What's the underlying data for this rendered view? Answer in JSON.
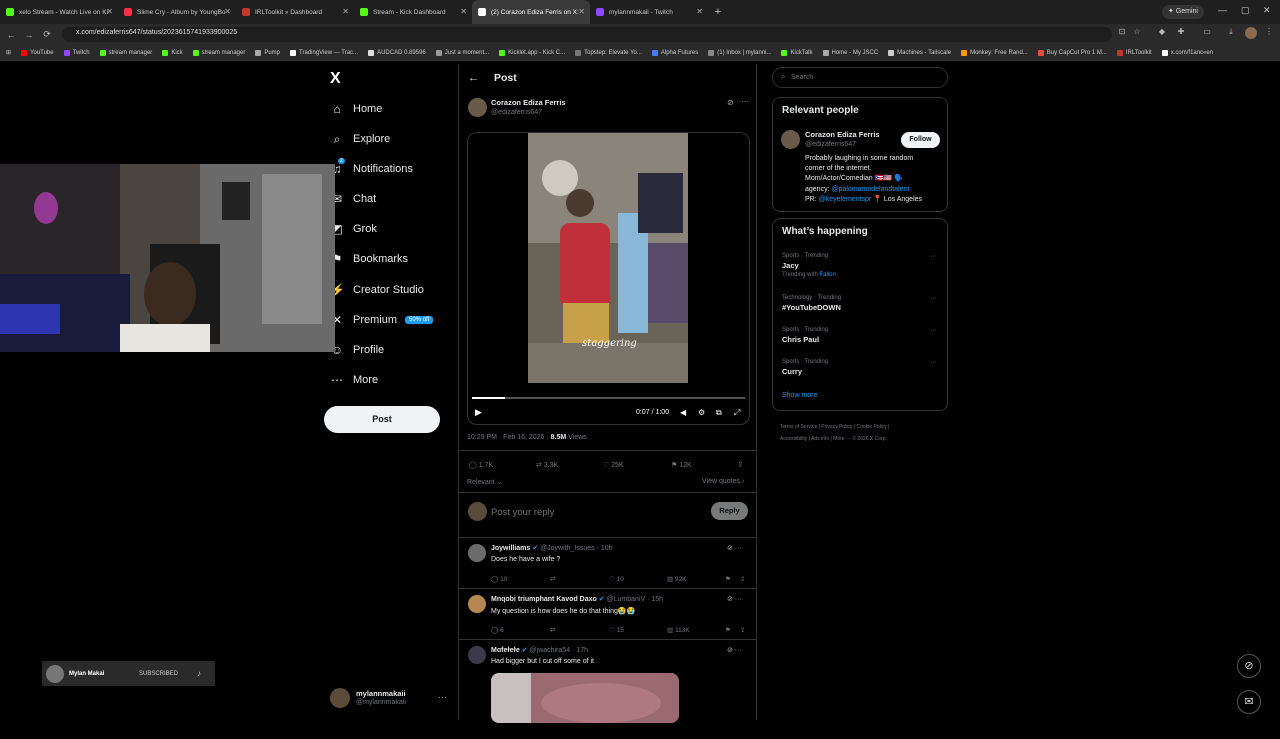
{
  "browser": {
    "tabs": [
      {
        "title": "xelo Stream - Watch Live on Ki",
        "color": "#53fc18"
      },
      {
        "title": "Slime Cry - Album by YoungBo",
        "color": "#fa2d48"
      },
      {
        "title": "IRLToolkit » Dashboard",
        "color": "#c0392b"
      },
      {
        "title": "Stream - Kick Dashboard",
        "color": "#53fc18"
      },
      {
        "title": "(2) Corazon Ediza Ferris on X:",
        "color": "#ffffff"
      },
      {
        "title": "mylannmakaii - Twitch",
        "color": "#9146ff"
      }
    ],
    "new_tab": "+",
    "gemini": "Gemini",
    "url": "x.com/edizaferris647/status/2023615741933900025",
    "bookmarks": [
      "YouTube",
      "Twitch",
      "stream manager",
      "Kick",
      "stream manager",
      "Pump",
      "TradingView — Trac...",
      "AUDCAD 0.89596",
      "Just a moment...",
      "Kicklet.app - Kick C...",
      "Topstep: Elevate Yo...",
      "Alpha Futures",
      "(1) Inbox | mylanni...",
      "KickTalk",
      "Home - My JSCC",
      "Machines - Tailscale",
      "Monkey: Free Rand...",
      "Buy CapCut Pro 1 M...",
      "IRLToolkit",
      "x.com/f1anc«en"
    ]
  },
  "sidebar": {
    "logo": "X",
    "items": [
      {
        "label": "Home",
        "icon": "home-icon",
        "glyph": "⌂"
      },
      {
        "label": "Explore",
        "icon": "search-icon",
        "glyph": "⌕"
      },
      {
        "label": "Notifications",
        "icon": "bell-icon",
        "glyph": "♫"
      },
      {
        "label": "Chat",
        "icon": "chat-icon",
        "glyph": "✉"
      },
      {
        "label": "Grok",
        "icon": "grok-icon",
        "glyph": "◩"
      },
      {
        "label": "Bookmarks",
        "icon": "bookmark-icon",
        "glyph": "⚑"
      },
      {
        "label": "Creator Studio",
        "icon": "creator-icon",
        "glyph": "⚡"
      },
      {
        "label": "Premium",
        "icon": "x-premium-icon",
        "glyph": "✕"
      },
      {
        "label": "Profile",
        "icon": "profile-icon",
        "glyph": "☺"
      },
      {
        "label": "More",
        "icon": "more-icon",
        "glyph": "⋯"
      }
    ],
    "premium_badge": "50% off",
    "notif_count": "2",
    "post_button": "Post",
    "account_name": "mylannmakaii",
    "account_handle": "@mylannmakaii"
  },
  "overlay": {
    "sub_name": "Mylan Makai",
    "sub_status": "SUBSCRIBED"
  },
  "post": {
    "header": "Post",
    "author": "Corazon Ediza Ferris",
    "handle": "@edizaferris647",
    "caption": "staggering",
    "video_time": "0:07 / 1:00",
    "video_progress": 0.12,
    "timestamp": "10:29 PM · Feb 16, 2026 · ",
    "views": "8.5M",
    "views_label": " Views",
    "replies": "1.7K",
    "reposts": "3.3K",
    "likes": "25K",
    "bookmarks": "12K",
    "sort": "Relevant",
    "view_quotes": "View quotes",
    "reply_placeholder": "Post your reply",
    "reply_button": "Reply"
  },
  "replies": [
    {
      "name": "Joywilliams",
      "handle": "@Joywith_Issues · 10h",
      "text": "Does he have a wife ?",
      "replies": "10",
      "likes": "10",
      "views": "92K",
      "avatar": "#6b6b6b"
    },
    {
      "name": "Mnqobi triumphant Kavod Daxo",
      "handle": "@LumbaniV · 15h",
      "text": "My question is how does he do that thing😭😭",
      "replies": "6",
      "likes": "15",
      "views": "113K",
      "avatar": "#b48850"
    },
    {
      "name": "Mɑfeɫeɫe",
      "handle": "@jwachira54 · 17h",
      "text": "Had bigger but I cut off some of it",
      "replies": "",
      "likes": "",
      "views": "",
      "avatar": "#3a3a4a"
    }
  ],
  "right": {
    "search_placeholder": "Search",
    "relevant_title": "Relevant people",
    "rp_name": "Corazon Ediza Ferris",
    "rp_handle": "@edizaferris647",
    "follow": "Follow",
    "bio1": "Probably laughing in some random",
    "bio2": "corner of the internet.",
    "bio3": "Mom/Actor/Comedian 🇵🇷🇺🇸 🗣️",
    "bio4a": "agency: ",
    "bio4b": "@palomamodelandtalent",
    "bio5a": "PR: ",
    "bio5b": "@keyelementspr",
    "bio5c": " 📍 Los Angeles",
    "happening_title": "What’s happening",
    "trends": [
      {
        "context": "Sports · Trending",
        "title": "Jacy",
        "extra": "Trending with ",
        "extra_link": "Fallon"
      },
      {
        "context": "Technology · Trending",
        "title": "#YouTubeDOWN",
        "extra": "",
        "extra_link": ""
      },
      {
        "context": "Sports · Trending",
        "title": "Chris Paul",
        "extra": "",
        "extra_link": ""
      },
      {
        "context": "Sports · Trending",
        "title": "Curry",
        "extra": "",
        "extra_link": ""
      }
    ],
    "show_more": "Show more",
    "footer1": "Terms of Service  |  Privacy Policy  |  Cookie Policy  |",
    "footer2": "Accessibility  |  Ads info  |  More ···  © 2026 X Corp."
  }
}
